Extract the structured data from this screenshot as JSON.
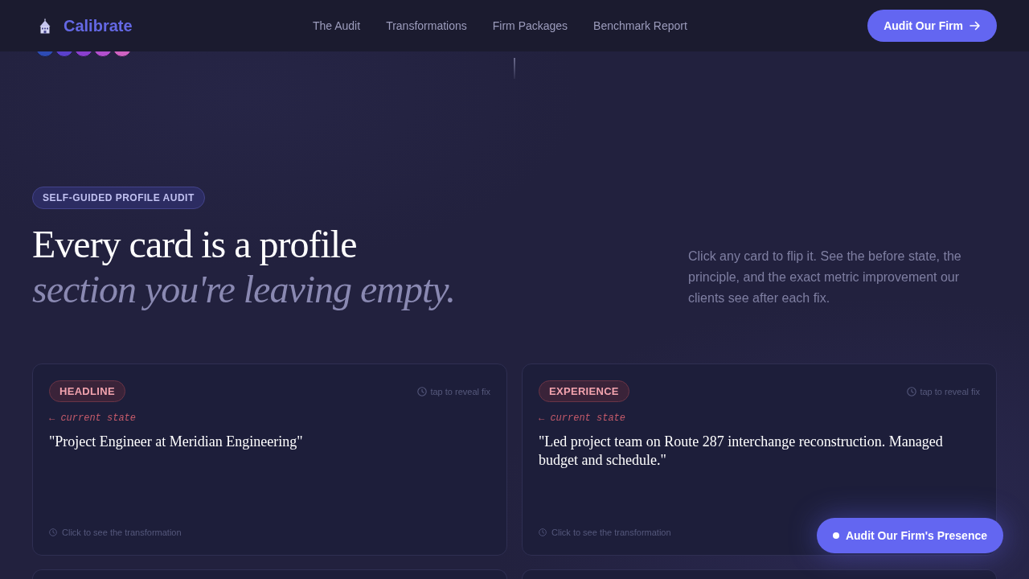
{
  "header": {
    "brand": "Calibrate",
    "nav": [
      "The Audit",
      "Transformations",
      "Firm Packages",
      "Benchmark Report"
    ],
    "cta": "Audit Our Firm"
  },
  "hero": {
    "badge": "SELF-GUIDED PROFILE AUDIT",
    "title": "Every card is a profile *section you're leaving empty.*",
    "intro": "Click any card to flip it. See the before state, the principle, and the exact metric improvement our clients see after each fix."
  },
  "cards": [
    {
      "tag": "HEADLINE",
      "hint": "tap to reveal fix",
      "state_label": "← current state",
      "quote": "\"Project Engineer at Meridian Engineering\"",
      "footer": "Click to see the transformation"
    },
    {
      "tag": "EXPERIENCE",
      "hint": "tap to reveal fix",
      "state_label": "← current state",
      "quote": "\"Led project team on Route 287 interchange reconstruction. Managed budget and schedule.\"",
      "footer": "Click to see the transformation"
    }
  ],
  "floating_button": "Audit Our Firm's Presence"
}
